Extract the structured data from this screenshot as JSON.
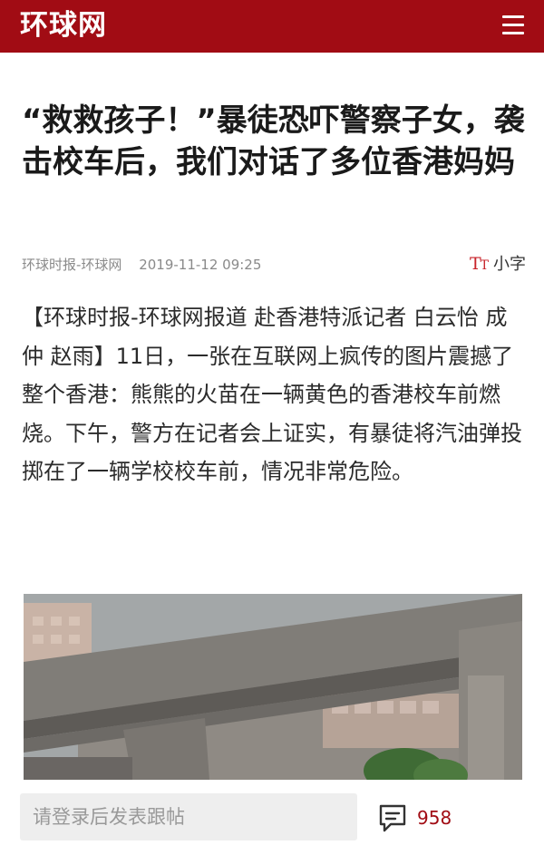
{
  "header": {
    "logo_text": "环球网",
    "menu_icon": "hamburger-menu-icon"
  },
  "article": {
    "title": "“救救孩子！”暴徒恐吓警察子女，袭击校车后，我们对话了多位香港妈妈",
    "source": "环球时报-环球网",
    "datetime": "2019-11-12 09:25",
    "font_toggle_label": "小字",
    "font_toggle_icon": "text-size-icon",
    "paragraph": "【环球时报-环球网报道 赴香港特派记者 白云怡 成仲 赵雨】11日，一张在互联网上疯传的图片震撼了整个香港：熊熊的火苗在一辆黄色的香港校车前燃烧。下午，警方在记者会上证实，有暴徒将汽油弹投掷在了一辆学校校车前，情况非常危险。"
  },
  "bottom_bar": {
    "comment_placeholder": "请登录后发表跟帖",
    "comment_icon": "comment-icon",
    "comment_count": "958"
  },
  "colors": {
    "brand": "#a10c14",
    "accent": "#c8242b"
  }
}
